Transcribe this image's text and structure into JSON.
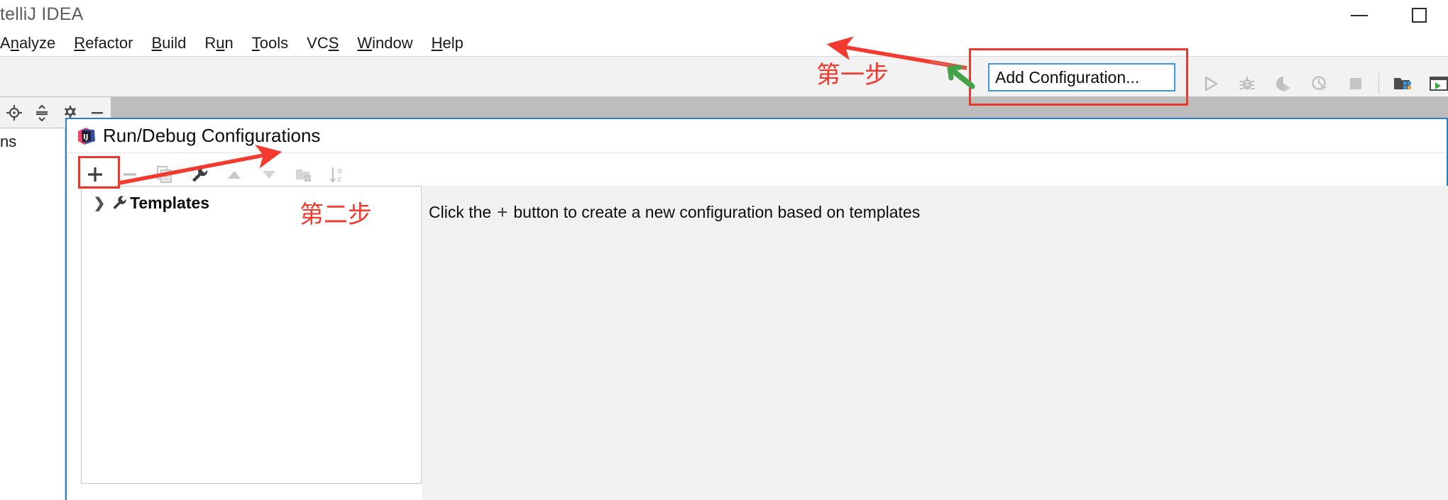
{
  "window": {
    "title": "telliJ IDEA",
    "minimize_label": "minimize",
    "maximize_label": "maximize"
  },
  "menubar": {
    "items": [
      {
        "label": "Analyze",
        "mnemonic": "z"
      },
      {
        "label": "Refactor",
        "mnemonic": "R"
      },
      {
        "label": "Build",
        "mnemonic": "B"
      },
      {
        "label": "Run",
        "mnemonic": "u"
      },
      {
        "label": "Tools",
        "mnemonic": "T"
      },
      {
        "label": "VCS",
        "mnemonic": "S"
      },
      {
        "label": "Window",
        "mnemonic": "W"
      },
      {
        "label": "Help",
        "mnemonic": "H"
      }
    ]
  },
  "toolbar": {
    "add_configuration_label": "Add Configuration...",
    "run_icons": [
      {
        "name": "run-icon",
        "title": "Run"
      },
      {
        "name": "debug-icon",
        "title": "Debug"
      },
      {
        "name": "run-with-coverage-icon",
        "title": "Run with Coverage"
      },
      {
        "name": "profile-icon",
        "title": "Profile"
      },
      {
        "name": "stop-icon",
        "title": "Stop"
      },
      {
        "name": "project-structure-icon",
        "title": "Project Structure"
      },
      {
        "name": "terminal-icon",
        "title": "Terminal"
      }
    ],
    "left_icons": [
      {
        "name": "locate-icon",
        "title": "Select Opened File"
      },
      {
        "name": "collapse-all-icon",
        "title": "Collapse All"
      },
      {
        "name": "gear-icon",
        "title": "Settings"
      },
      {
        "name": "hide-icon",
        "title": "Hide"
      }
    ]
  },
  "project_panel": {
    "truncated_label": "ns"
  },
  "dialog": {
    "title": "Run/Debug Configurations",
    "logo_name": "intellij-idea-logo",
    "toolbar": [
      {
        "name": "add-button",
        "glyph": "+",
        "enabled": true
      },
      {
        "name": "remove-button",
        "glyph": "–",
        "enabled": false
      },
      {
        "name": "copy-button",
        "glyph": "copy",
        "enabled": false
      },
      {
        "name": "edit-templates-button",
        "glyph": "wrench",
        "enabled": true
      },
      {
        "name": "move-up-button",
        "glyph": "triangle-up",
        "enabled": false
      },
      {
        "name": "move-down-button",
        "glyph": "triangle-down",
        "enabled": false
      },
      {
        "name": "folder-button",
        "glyph": "folder-add",
        "enabled": false
      },
      {
        "name": "sort-alpha-button",
        "glyph": "sort-az",
        "enabled": false
      }
    ],
    "tree": {
      "items": [
        {
          "label": "Templates",
          "icon": "wrench-icon",
          "expanded": false
        }
      ]
    },
    "content_hint": {
      "before": "Click the",
      "plus": "+",
      "after": "button to create a new configuration based on templates"
    }
  },
  "annotations": {
    "step1": "第一步",
    "step2": "第二步",
    "arrow_color": "#f4392e",
    "green_arrow_color": "#46a247",
    "highlight_color": "#e8392f",
    "combo_border_color": "#3d9ae0"
  }
}
